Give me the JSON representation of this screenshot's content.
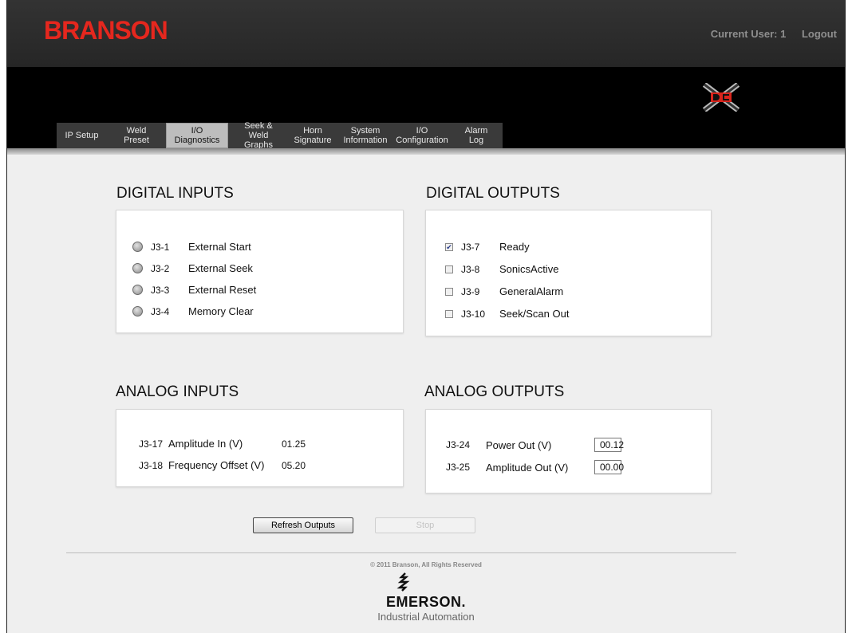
{
  "brand": {
    "logo": "BRANSON",
    "logo_color": "#e5271e"
  },
  "userbar": {
    "current_user": "Current User: 1",
    "logout": "Logout"
  },
  "tabs": [
    {
      "label": "IP Setup"
    },
    {
      "label": "Weld Preset"
    },
    {
      "label": "I/O Diagnostics",
      "active": true
    },
    {
      "label": "Seek &\nWeld Graphs"
    },
    {
      "label": "Horn\nSignature"
    },
    {
      "label": "System\nInformation"
    },
    {
      "label": "I/O\nConfiguration"
    },
    {
      "label": "Alarm Log"
    }
  ],
  "digital_inputs": {
    "title": "DIGITAL INPUTS",
    "rows": [
      {
        "pin": "J3-1",
        "label": "External Start"
      },
      {
        "pin": "J3-2",
        "label": "External Seek"
      },
      {
        "pin": "J3-3",
        "label": "External Reset"
      },
      {
        "pin": "J3-4",
        "label": "Memory Clear"
      }
    ]
  },
  "digital_outputs": {
    "title": "DIGITAL OUTPUTS",
    "rows": [
      {
        "pin": "J3-7",
        "label": "Ready",
        "checked": true
      },
      {
        "pin": "J3-8",
        "label": "SonicsActive",
        "checked": false
      },
      {
        "pin": "J3-9",
        "label": "GeneralAlarm",
        "checked": false
      },
      {
        "pin": "J3-10",
        "label": "Seek/Scan Out",
        "checked": false
      }
    ]
  },
  "analog_inputs": {
    "title": "ANALOG INPUTS",
    "rows": [
      {
        "pin": "J3-17",
        "label": "Amplitude In (V)",
        "value": "01.25"
      },
      {
        "pin": "J3-18",
        "label": "Frequency Offset (V)",
        "value": "05.20"
      }
    ]
  },
  "analog_outputs": {
    "title": "ANALOG OUTPUTS",
    "rows": [
      {
        "pin": "J3-24",
        "label": "Power Out (V)",
        "value": "00.12"
      },
      {
        "pin": "J3-25",
        "label": "Amplitude Out (V)",
        "value": "00.00"
      }
    ]
  },
  "buttons": {
    "refresh": "Refresh Outputs",
    "stop": "Stop"
  },
  "footer": {
    "copyright": "© 2011 Branson, All Rights Reserved",
    "emerson": "EMERSON.",
    "industrial": "Industrial Automation"
  },
  "icons": {
    "dc_logo": "dc-logo-icon",
    "emerson_mark": "emerson-mark-icon",
    "led": "status-led-icon",
    "checkbox": "checkbox-icon"
  }
}
